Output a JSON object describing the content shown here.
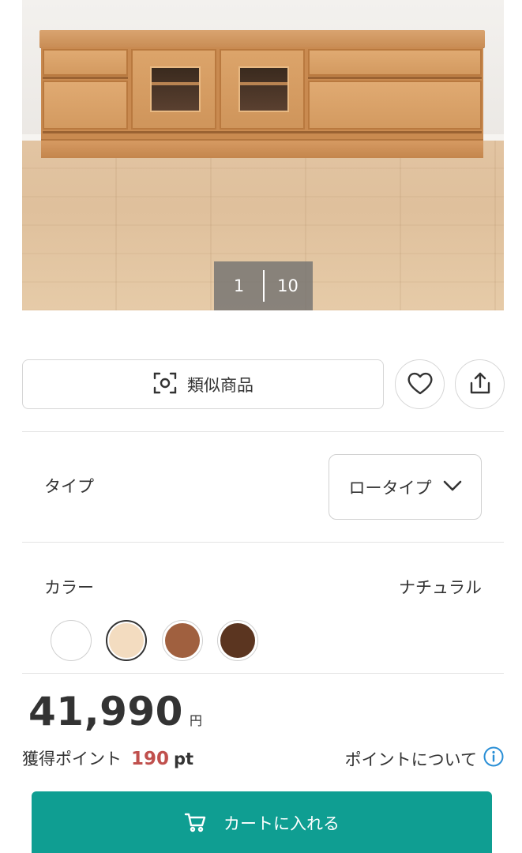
{
  "gallery": {
    "current": "1",
    "total": "10"
  },
  "actions": {
    "similar_label": "類似商品",
    "similar_icon": "image-search-icon",
    "favorite_icon": "heart-icon",
    "share_icon": "share-icon"
  },
  "type_option": {
    "label": "タイプ",
    "selected": "ロータイプ",
    "icon": "chevron-down-icon"
  },
  "color_option": {
    "label": "カラー",
    "selected": "ナチュラル",
    "swatches": [
      {
        "color": "#ffffff",
        "selected": false
      },
      {
        "color": "#f3dcc0",
        "selected": true
      },
      {
        "color": "#a0603f",
        "selected": false
      },
      {
        "color": "#5b3520",
        "selected": false
      }
    ]
  },
  "price": {
    "amount": "41,990",
    "currency": "円"
  },
  "points": {
    "label": "獲得ポイント",
    "value": "190",
    "unit": "pt",
    "about_label": "ポイントについて",
    "about_icon": "info-icon"
  },
  "cart": {
    "label": "カートに入れる",
    "icon": "cart-icon"
  },
  "colors": {
    "accent": "#0f9e92",
    "points_highlight": "#c0504d",
    "info_icon": "#2a8fd6"
  }
}
